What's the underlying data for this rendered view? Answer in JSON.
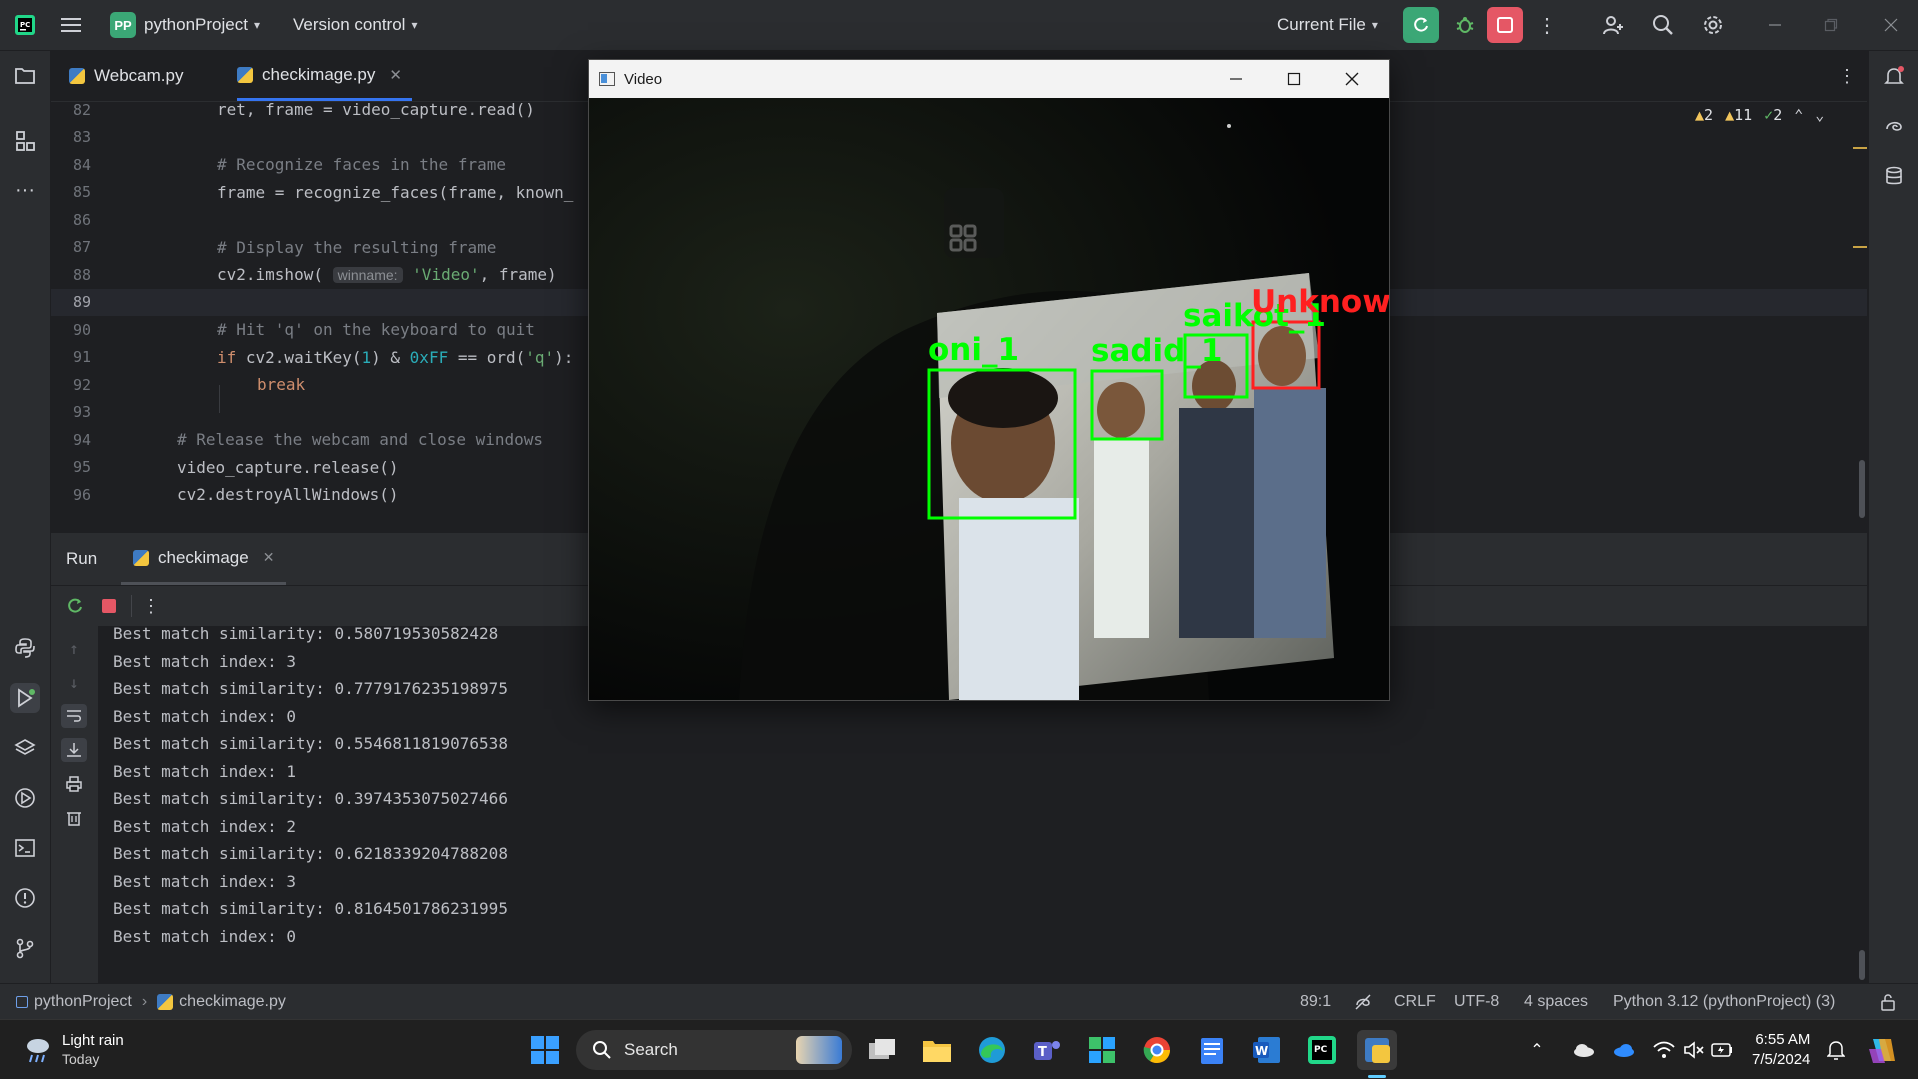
{
  "titlebar": {
    "project_badge": "PP",
    "project_name": "pythonProject",
    "vcs": "Version control",
    "run_config": "Current File",
    "colors": {
      "badge": "#3ba776",
      "run": "#3ba776",
      "stop": "#e55765"
    }
  },
  "editor": {
    "tabs": [
      {
        "label": "Webcam.py"
      },
      {
        "label": "checkimage.py"
      }
    ],
    "line_numbers": [
      "82",
      "83",
      "84",
      "85",
      "86",
      "87",
      "88",
      "89",
      "90",
      "91",
      "92",
      "93",
      "94",
      "95",
      "96"
    ],
    "lines": {
      "l82": "ret, frame = video_capture.read()",
      "l84": "# Recognize faces in the frame",
      "l85": "frame = recognize_faces(frame, known_",
      "l87": "# Display the resulting frame",
      "l88_a": "cv2.imshow(",
      "l88_hint": "winname:",
      "l88_str": "'Video'",
      "l88_b": ", frame)",
      "l90": "# Hit 'q' on the keyboard to quit",
      "l91_kw": "if",
      "l91_a": " cv2.waitKey(",
      "l91_n1": "1",
      "l91_b": ") & ",
      "l91_n2": "0xFF",
      "l91_c": " == ord(",
      "l91_s": "'q'",
      "l91_d": "):",
      "l92": "break",
      "l94": "# Release the webcam and close windows",
      "l95": "video_capture.release()",
      "l96": "cv2.destroyAllWindows()"
    },
    "inspections": {
      "warnings_a": "2",
      "warnings_b": "11",
      "ok": "2"
    }
  },
  "run": {
    "title": "Run",
    "tab": "checkimage",
    "output": [
      "Best match similarity: 0.580719530582428",
      "Best match index: 3",
      "Best match similarity: 0.7779176235198975",
      "Best match index: 0",
      "Best match similarity: 0.5546811819076538",
      "Best match index: 1",
      "Best match similarity: 0.3974353075027466",
      "Best match index: 2",
      "Best match similarity: 0.6218339204788208",
      "Best match index: 3",
      "Best match similarity: 0.8164501786231995",
      "Best match index: 0"
    ]
  },
  "video": {
    "title": "Video",
    "labels": [
      "oni_1",
      "sadid_1",
      "saikot_1",
      "Unknown"
    ],
    "colors": {
      "known": "#00ff00",
      "unknown": "#ff2020"
    }
  },
  "statusbar": {
    "crumb_project": "pythonProject",
    "crumb_file": "checkimage.py",
    "position": "89:1",
    "line_sep": "CRLF",
    "encoding": "UTF-8",
    "indent": "4 spaces",
    "interpreter": "Python 3.12 (pythonProject) (3)"
  },
  "taskbar": {
    "weather_title": "Light rain",
    "weather_sub": "Today",
    "search": "Search",
    "time": "6:55 AM",
    "date": "7/5/2024"
  }
}
